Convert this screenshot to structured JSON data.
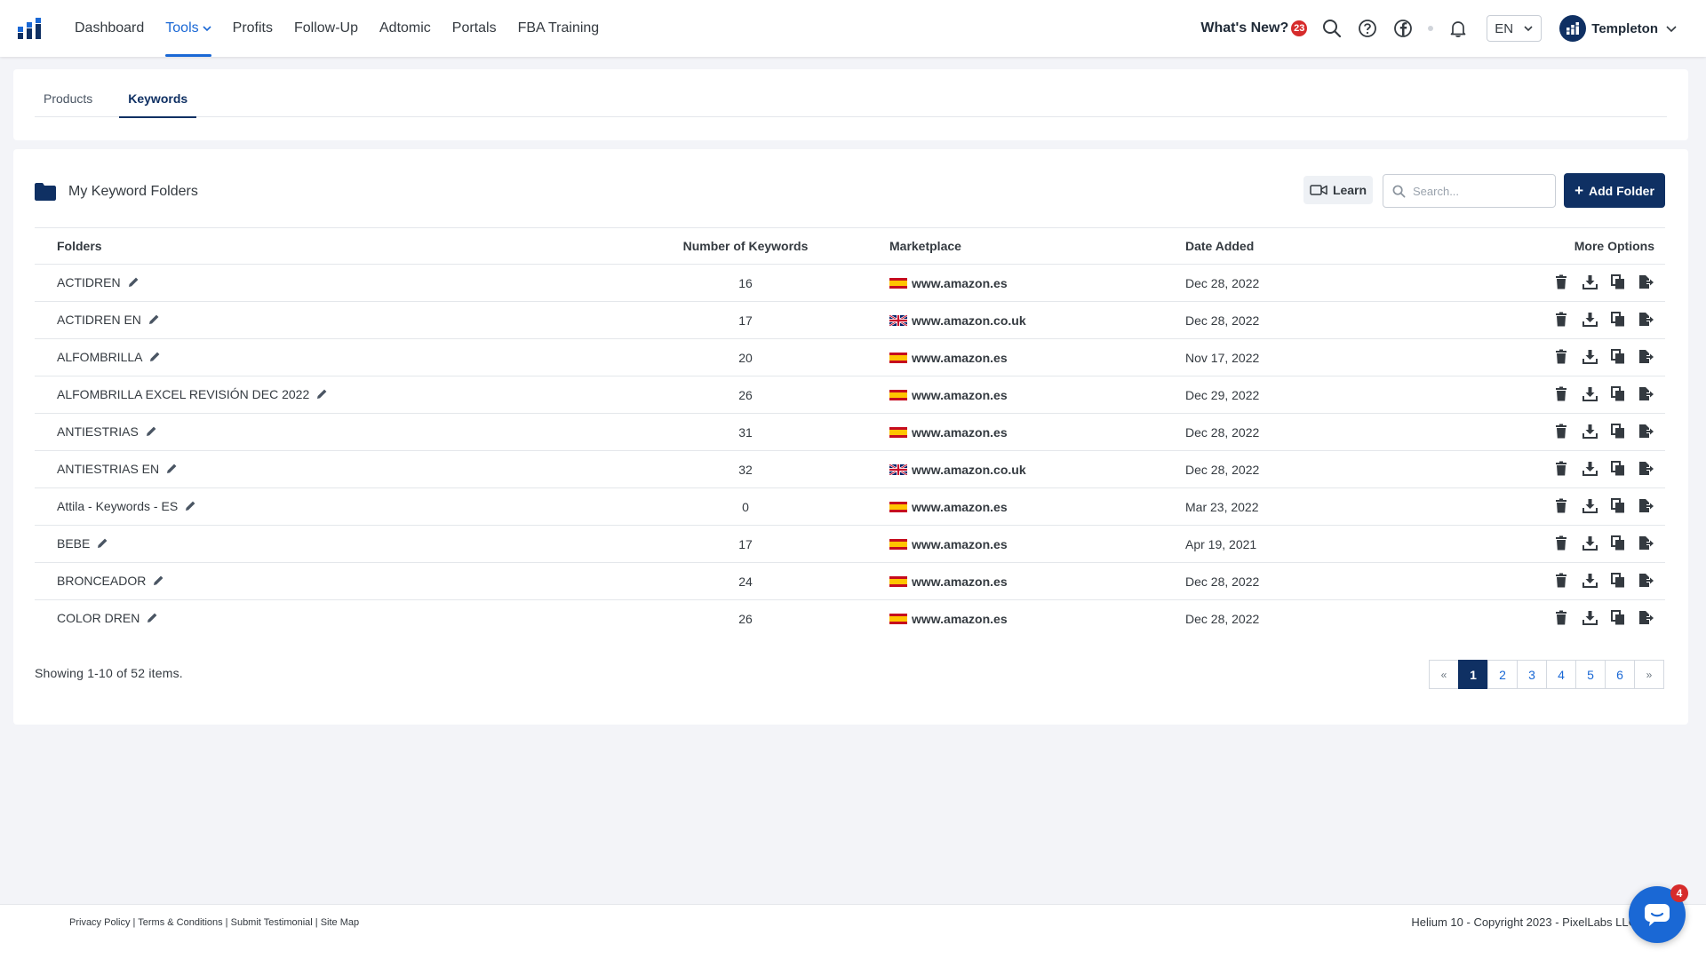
{
  "nav": {
    "items": [
      {
        "label": "Dashboard"
      },
      {
        "label": "Tools"
      },
      {
        "label": "Profits"
      },
      {
        "label": "Follow-Up"
      },
      {
        "label": "Adtomic"
      },
      {
        "label": "Portals"
      },
      {
        "label": "FBA Training"
      }
    ],
    "active": "Tools",
    "whats_new": "What's New?",
    "whats_new_count": "23",
    "language": "EN",
    "user_name": "Templeton"
  },
  "tabs": [
    {
      "label": "Products"
    },
    {
      "label": "Keywords"
    }
  ],
  "active_tab": "Keywords",
  "folders": {
    "title": "My Keyword Folders",
    "learn_label": "Learn",
    "search_placeholder": "Search...",
    "add_label": "Add Folder",
    "columns": [
      "Folders",
      "Number of Keywords",
      "Marketplace",
      "Date Added",
      "More Options"
    ],
    "rows": [
      {
        "name": "ACTIDREN",
        "count": "16",
        "flag": "es",
        "marketplace": "www.amazon.es",
        "date": "Dec 28, 2022"
      },
      {
        "name": "ACTIDREN EN",
        "count": "17",
        "flag": "uk",
        "marketplace": "www.amazon.co.uk",
        "date": "Dec 28, 2022"
      },
      {
        "name": "ALFOMBRILLA",
        "count": "20",
        "flag": "es",
        "marketplace": "www.amazon.es",
        "date": "Nov 17, 2022"
      },
      {
        "name": "ALFOMBRILLA EXCEL REVISIÓN DEC 2022",
        "count": "26",
        "flag": "es",
        "marketplace": "www.amazon.es",
        "date": "Dec 29, 2022"
      },
      {
        "name": "ANTIESTRIAS",
        "count": "31",
        "flag": "es",
        "marketplace": "www.amazon.es",
        "date": "Dec 28, 2022"
      },
      {
        "name": "ANTIESTRIAS EN",
        "count": "32",
        "flag": "uk",
        "marketplace": "www.amazon.co.uk",
        "date": "Dec 28, 2022"
      },
      {
        "name": "Attila - Keywords - ES",
        "count": "0",
        "flag": "es",
        "marketplace": "www.amazon.es",
        "date": "Mar 23, 2022"
      },
      {
        "name": "BEBE",
        "count": "17",
        "flag": "es",
        "marketplace": "www.amazon.es",
        "date": "Apr 19, 2021"
      },
      {
        "name": "BRONCEADOR",
        "count": "24",
        "flag": "es",
        "marketplace": "www.amazon.es",
        "date": "Dec 28, 2022"
      },
      {
        "name": "COLOR DREN",
        "count": "26",
        "flag": "es",
        "marketplace": "www.amazon.es",
        "date": "Dec 28, 2022"
      }
    ],
    "showing": "Showing 1-10 of 52 items.",
    "pages": [
      "«",
      "1",
      "2",
      "3",
      "4",
      "5",
      "6",
      "»"
    ],
    "current_page": "1"
  },
  "footer": {
    "links": [
      "Privacy Policy",
      "Terms & Conditions",
      "Submit Testimonial",
      "Site Map"
    ],
    "copyright": "Helium 10 - Copyright 2023 - PixelLabs LLC"
  },
  "chat_badge": "4",
  "colors": {
    "primary": "#0f3063",
    "accent": "#1a68d5",
    "badge": "#d62b2b",
    "background": "#f3f4f8"
  },
  "icons": {
    "row_options": [
      "trash-icon",
      "download-icon",
      "copy-icon",
      "export-icon"
    ],
    "nav": [
      "search-icon",
      "help-icon",
      "facebook-icon",
      "bell-icon"
    ]
  }
}
